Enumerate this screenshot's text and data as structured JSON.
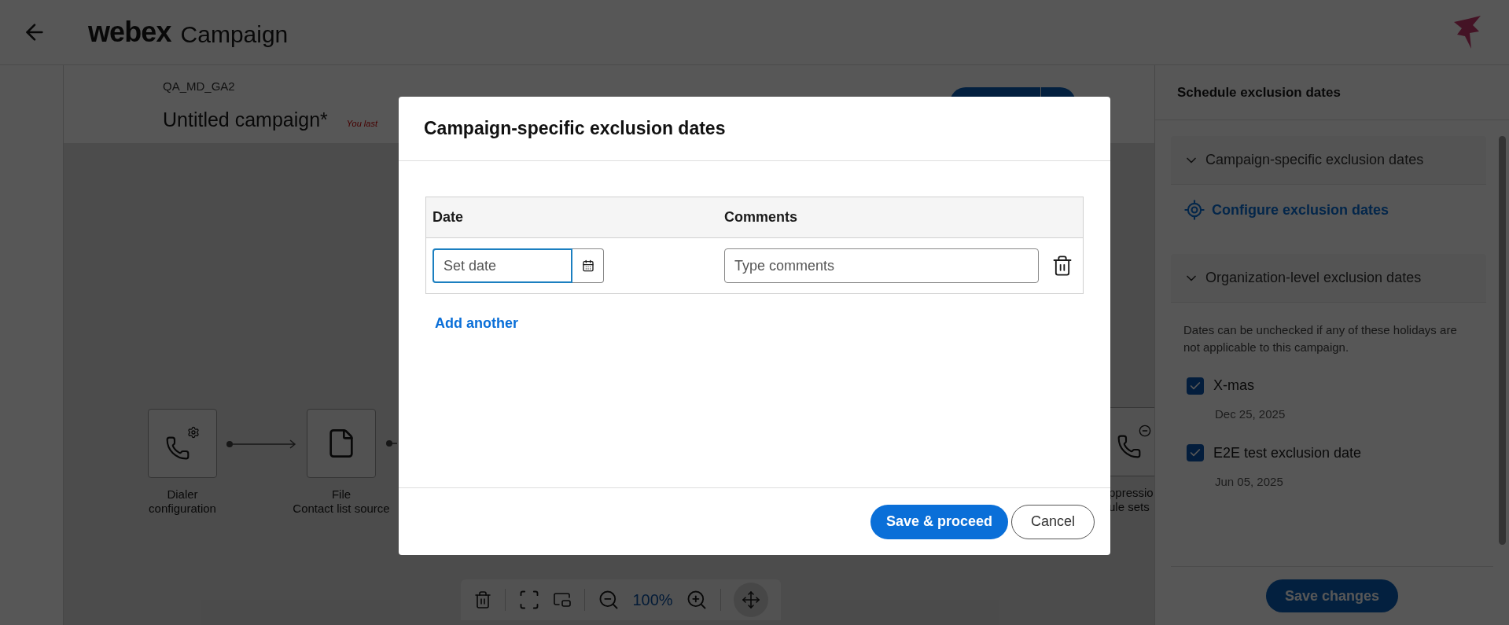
{
  "header": {
    "brand": "webex",
    "title": "Campaign"
  },
  "campaign": {
    "org": "QA_MD_GA2",
    "name": "Untitled campaign*",
    "save_note": "You last"
  },
  "flow": {
    "nodes": [
      {
        "kind": "dialer",
        "lines": [
          "Dialer configuration"
        ]
      },
      {
        "kind": "file",
        "lines": [
          "File",
          "Contact list source"
        ]
      },
      {
        "kind": "suppression",
        "lines": [
          "ppressio",
          "ule sets"
        ]
      }
    ]
  },
  "toolbar": {
    "zoom": "100%"
  },
  "panel": {
    "title": "Schedule exclusion dates",
    "sections": [
      {
        "title": "Campaign-specific exclusion dates",
        "expanded": true,
        "link": "Configure exclusion dates"
      },
      {
        "title": "Organization-level exclusion dates",
        "expanded": true,
        "note": "Dates can be unchecked if any of these holidays are not applicable to this campaign.",
        "holidays": [
          {
            "name": "X-mas",
            "date": "Dec 25, 2025",
            "checked": true
          },
          {
            "name": "E2E test exclusion date",
            "date": "Jun 05, 2025",
            "checked": true
          }
        ]
      }
    ],
    "save": "Save changes"
  },
  "dialog": {
    "title": "Campaign-specific exclusion dates",
    "columns": [
      "Date",
      "Comments"
    ],
    "rows": [
      {
        "date_placeholder": "Set date",
        "comments_placeholder": "Type comments"
      }
    ],
    "add": "Add another",
    "buttons": [
      "Save & proceed",
      "Cancel"
    ]
  }
}
